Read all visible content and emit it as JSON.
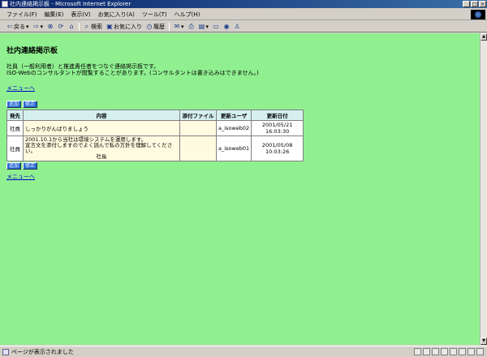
{
  "window": {
    "title": "社内連絡掲示板 - Microsoft Internet Explorer"
  },
  "menubar": {
    "items": [
      "ファイル(F)",
      "編集(E)",
      "表示(V)",
      "お気に入り(A)",
      "ツール(T)",
      "ヘルプ(H)"
    ]
  },
  "toolbar": {
    "back": "戻る",
    "search": "検索",
    "favorites": "お気に入り",
    "history": "履歴"
  },
  "page": {
    "title": "社内連絡掲示板",
    "desc_line1": "社員（一般利用者）と推進責任者をつなぐ連絡掲示板です。",
    "desc_line2": "ISO-Webのコンサルタントが閲覧することがあります。(コンサルタントは書き込みはできません。)",
    "menu_link_top": "メニューへ",
    "menu_link_bottom": "メニューへ",
    "btn_add": "追加",
    "btn_edit": "修正"
  },
  "table": {
    "headers": [
      "発先",
      "内容",
      "添付ファイル",
      "更新ユーザ",
      "更新日付"
    ],
    "rows": [
      {
        "sender": "社員",
        "content_lines": [
          "しっかりがんばりましょう"
        ],
        "file": "",
        "user": "a_isoweb02",
        "date": "2001/05/21 16:03:30"
      },
      {
        "sender": "社員",
        "content_lines": [
          "2001.10.1から当社は環境システムを運用します。",
          "宣言文を添付しますのでよく読んで私の方針を理解してください。",
          "社長"
        ],
        "file": "",
        "user": "a_isoweb01",
        "date": "2001/05/08 10:03:26"
      }
    ]
  },
  "statusbar": {
    "text": "ページが表示されました"
  },
  "colors": {
    "page_bg": "#90f090",
    "header_bg": "#d6f0f0",
    "cell_cream": "#fffbe0",
    "link": "#0000cc"
  }
}
